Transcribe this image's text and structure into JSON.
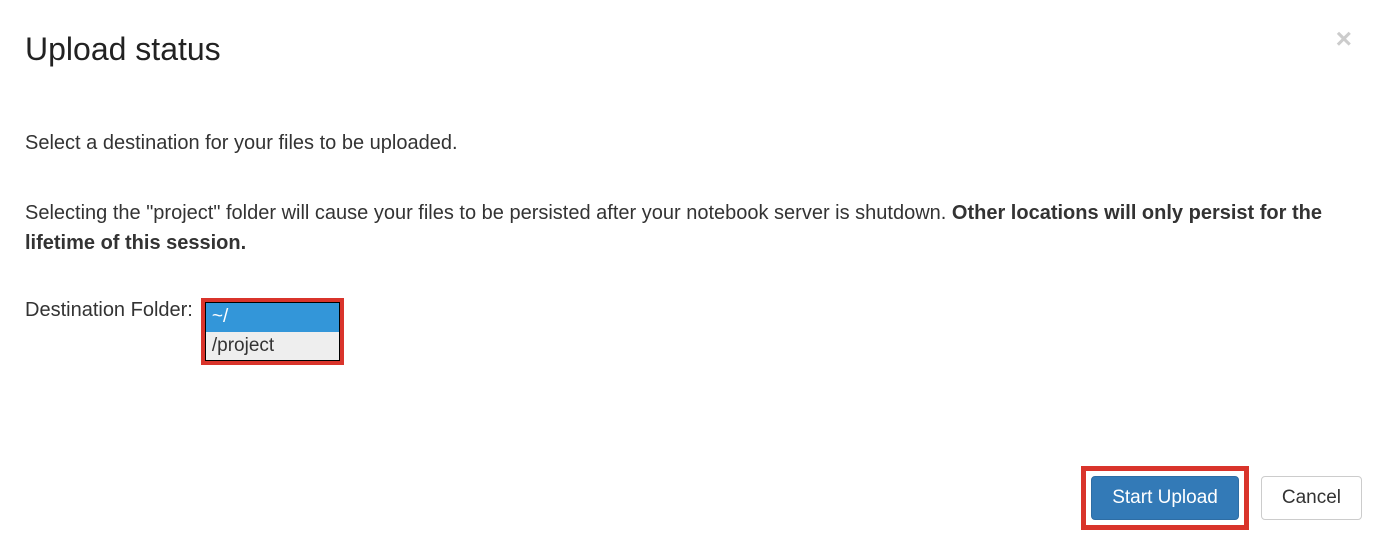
{
  "modal": {
    "title": "Upload status",
    "close_symbol": "×",
    "instruction_1": "Select a destination for your files to be uploaded.",
    "instruction_2a": "Selecting the \"project\" folder will cause your files to be persisted after your notebook server is shutdown. ",
    "instruction_2b": "Other locations will only persist for the lifetime of this session.",
    "destination_label": "Destination Folder: ",
    "folder_options": {
      "selected": "~/",
      "other": "/project"
    },
    "buttons": {
      "start": "Start Upload",
      "cancel": "Cancel"
    }
  }
}
